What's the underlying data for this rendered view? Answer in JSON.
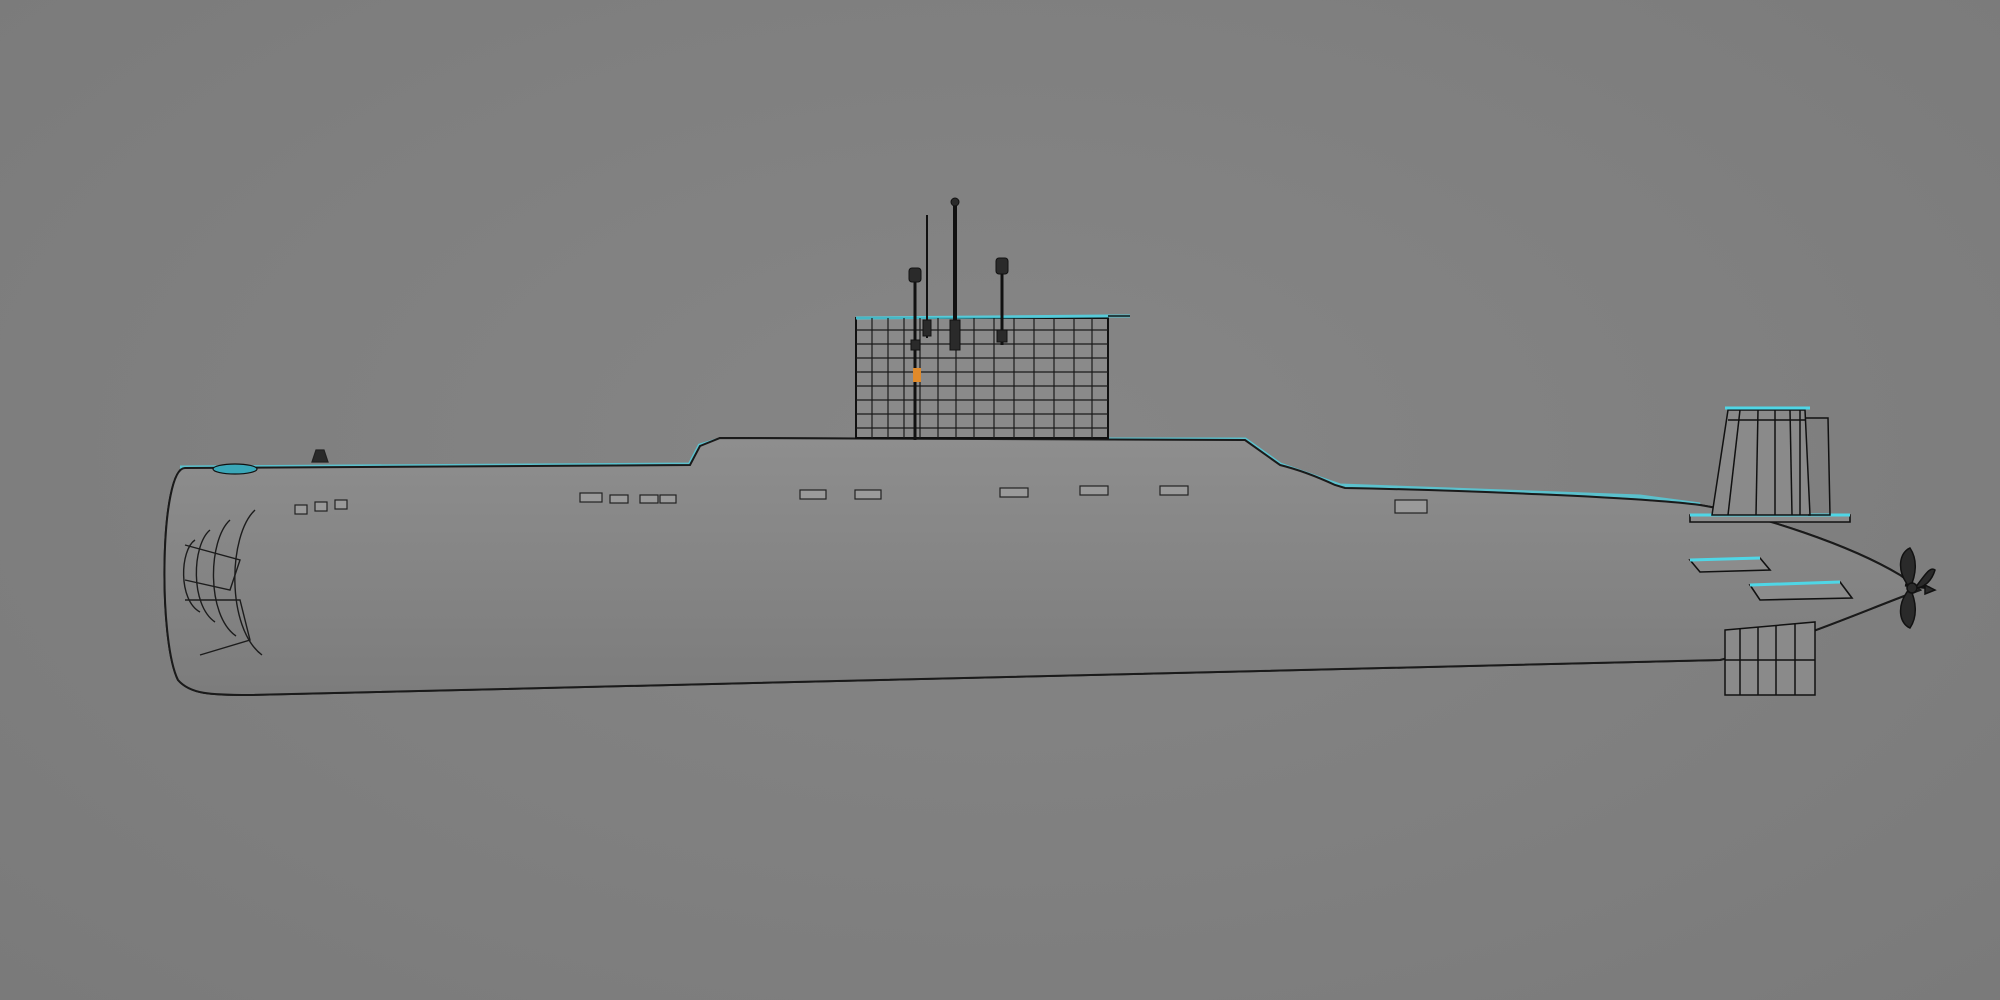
{
  "viewport": {
    "background": "#808080"
  },
  "model": {
    "subject": "submarine",
    "render_style": "wireframe",
    "view": "side",
    "colors": {
      "wire": "#1a1a1a",
      "highlight": "#4fd6e6",
      "accent": "#e08a2a",
      "hull_fill": "#8a8a8a"
    }
  }
}
